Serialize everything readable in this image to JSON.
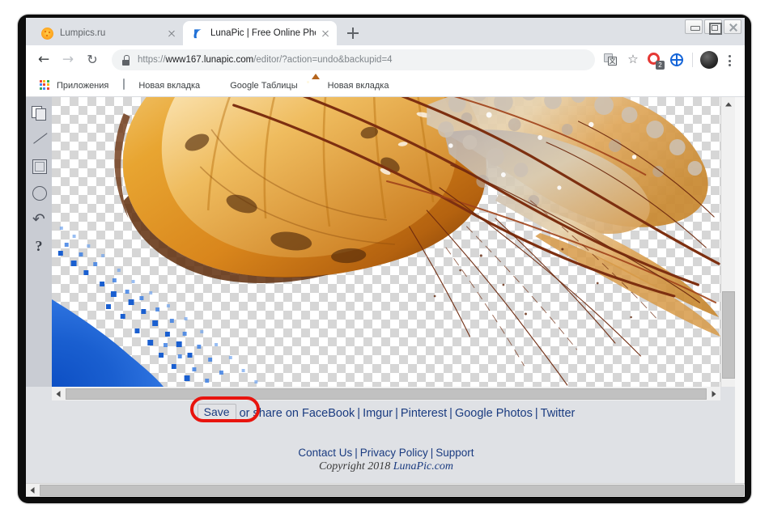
{
  "window": {
    "controls": {
      "minimize": "minimize-button",
      "maximize": "maximize-button",
      "close": "close-button"
    }
  },
  "browser": {
    "tabs": [
      {
        "title": "Lumpics.ru",
        "favicon": "lumpics-favicon",
        "active": false
      },
      {
        "title": "LunaPic | Free Online Photo Edito",
        "favicon": "lunapic-favicon",
        "active": true
      }
    ],
    "new_tab_label": "+",
    "nav": {
      "back": "←",
      "forward": "→",
      "reload": "↻"
    },
    "omnibox": {
      "lock_icon": "lock-icon",
      "url_scheme": "https://",
      "url_domain": "www167.lunapic.com",
      "url_path": "/editor/?action=undo&backupid=4",
      "url_full": "https://www167.lunapic.com/editor/?action=undo&backupid=4"
    },
    "toolbar_icons": [
      {
        "name": "translate-icon",
        "label": "文"
      },
      {
        "name": "bookmark-star-icon",
        "label": "☆"
      },
      {
        "name": "extension-red-icon",
        "badge": "2"
      },
      {
        "name": "extension-globe-icon",
        "label": ""
      }
    ],
    "avatar": "user-avatar",
    "menu": "chrome-menu-icon",
    "bookmarks": [
      {
        "label": "Приложения",
        "icon": "apps-grid-icon"
      },
      {
        "label": "Новая вкладка",
        "icon": "page-icon"
      },
      {
        "label": "Google Таблицы",
        "icon": "sheets-icon"
      },
      {
        "label": "Новая вкладка",
        "icon": "photo-icon"
      }
    ]
  },
  "editor": {
    "tools": [
      {
        "name": "duplicate-tool",
        "icon": "copy-icon"
      },
      {
        "name": "line-tool",
        "icon": "line-icon"
      },
      {
        "name": "rectangle-tool",
        "icon": "square-icon"
      },
      {
        "name": "ellipse-tool",
        "icon": "circle-icon"
      },
      {
        "name": "undo-tool",
        "icon": "undo-arrow-icon",
        "glyph": "↶"
      },
      {
        "name": "help-tool",
        "icon": "question-mark-icon",
        "glyph": "?"
      }
    ],
    "canvas": {
      "background": "transparent-checkerboard",
      "image_subject": "jellyfish-cutout",
      "artifact": "blue-scatter-effect"
    },
    "share": {
      "save_label": "Save",
      "or_text": "or share on",
      "links": [
        "FaceBook",
        "Imgur",
        "Pinterest",
        "Google Photos",
        "Twitter"
      ],
      "separator": "|"
    },
    "footer": {
      "links": [
        "Contact Us",
        "Privacy Policy",
        "Support"
      ],
      "separator": "|",
      "copyright_prefix": "Copyright 2018 ",
      "copyright_site": "LunaPic.com"
    }
  },
  "annotation": {
    "type": "red-ellipse-highlight",
    "target": "Save",
    "color": "#e8140e"
  },
  "colors": {
    "accent_link": "#1a3b80",
    "annotation_red": "#e8140e",
    "chrome_tabstrip": "#dee1e6",
    "page_bg": "#dfe1e5",
    "tool_rail": "#c9ccd3",
    "jelly_amber": "#e09a2a",
    "jelly_dark": "#6b3310",
    "blue_scatter": "#1a5fd0"
  }
}
